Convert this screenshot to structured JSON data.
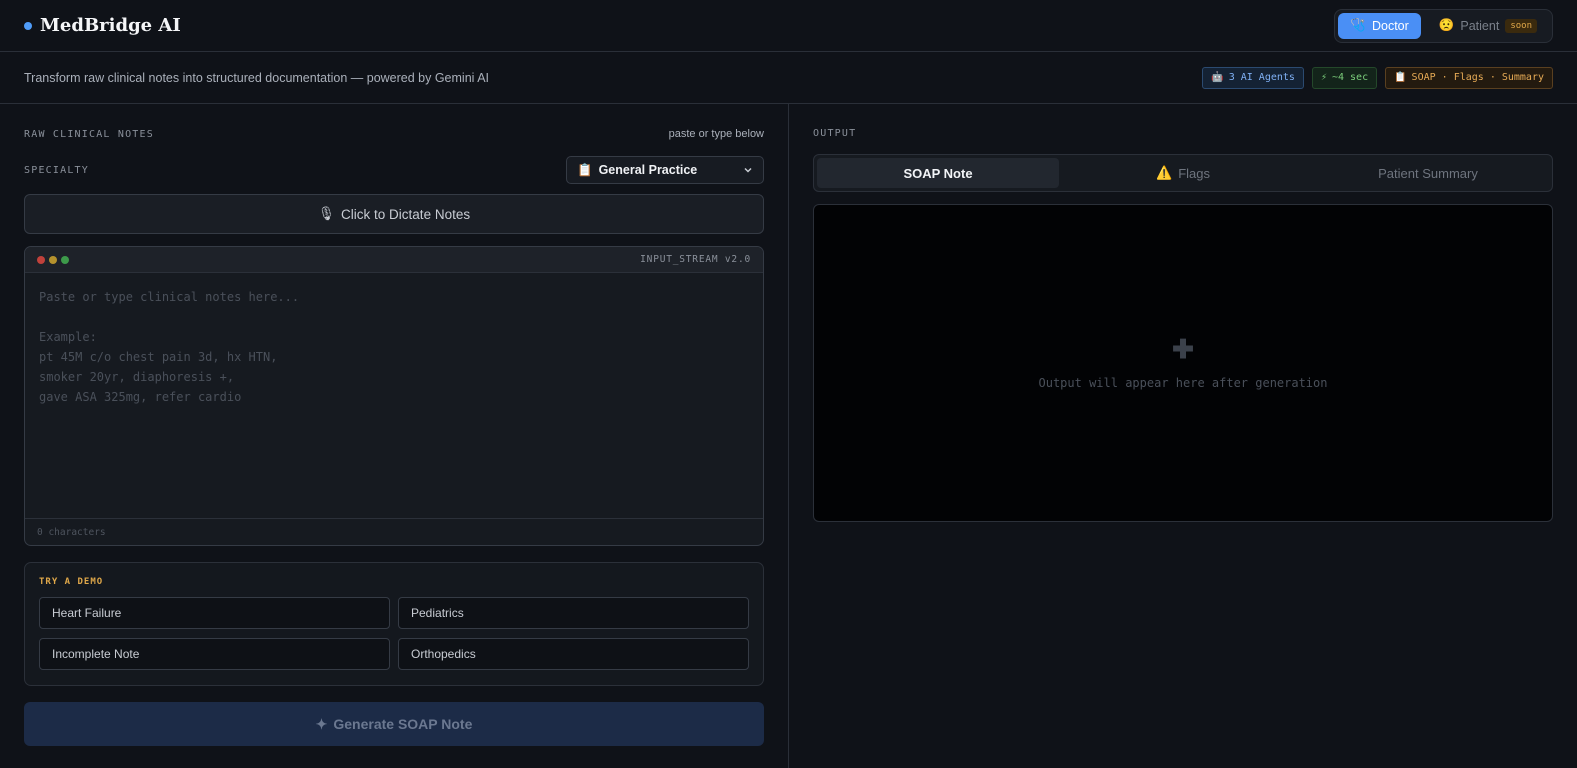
{
  "app": {
    "name": "MedBridge AI",
    "accent": "#4f9cf9"
  },
  "roles": {
    "doctor": {
      "label": "Doctor",
      "icon": "stethoscope-icon"
    },
    "patient": {
      "label": "Patient",
      "badge": "soon",
      "icon": "face-icon"
    }
  },
  "subheader": {
    "tagline": "Transform raw clinical notes into structured documentation — powered by Gemini AI",
    "badges": [
      {
        "label": "3 AI Agents",
        "icon": "robot-icon",
        "color": "#7fb0f5"
      },
      {
        "label": "~4 sec",
        "icon": "lightning-icon",
        "color": "#7ccf7c"
      },
      {
        "label": "SOAP · Flags · Summary",
        "icon": "clipboard-icon",
        "color": "#e6aa55"
      }
    ]
  },
  "input": {
    "section_label": "RAW CLINICAL NOTES",
    "hint": "paste or type below",
    "specialty_label": "SPECIALTY",
    "specialty_value": "General Practice",
    "dictate_label": "Click to Dictate Notes",
    "stream_label": "INPUT_STREAM v2.0",
    "placeholder": "Paste or type clinical notes here...\n\nExample:\npt 45M c/o chest pain 3d, hx HTN,\nsmoker 20yr, diaphoresis +,\ngave ASA 325mg, refer cardio",
    "char_count": "0 characters"
  },
  "demo": {
    "title": "TRY A DEMO",
    "items": [
      "Heart Failure",
      "Pediatrics",
      "Incomplete Note",
      "Orthopedics"
    ]
  },
  "generate_label": "Generate SOAP Note",
  "output": {
    "section_label": "OUTPUT",
    "tabs": [
      {
        "label": "SOAP Note",
        "active": true
      },
      {
        "label": "Flags",
        "icon": "warning-icon"
      },
      {
        "label": "Patient Summary"
      }
    ],
    "empty_text": "Output will appear here after generation"
  }
}
